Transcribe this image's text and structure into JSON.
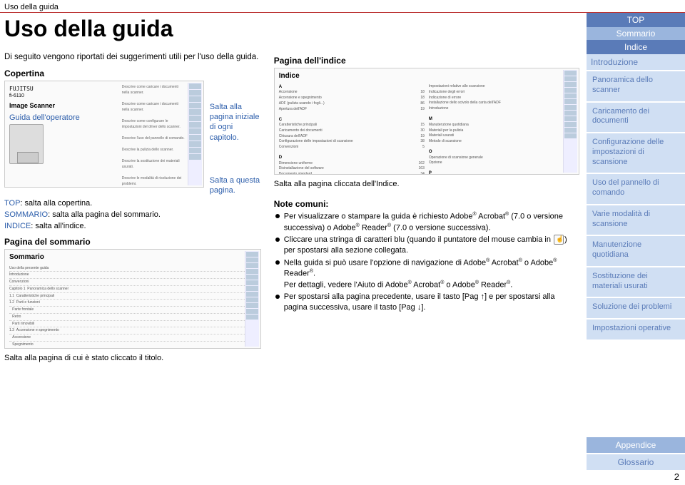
{
  "header": {
    "breadcrumb": "Uso della guida"
  },
  "title": "Uso della guida",
  "intro": "Di seguito vengono riportati dei suggerimenti utili per l'uso della guida.",
  "cover": {
    "heading": "Copertina",
    "brand": "FUJITSU",
    "model": "fi-6110",
    "big": "Image Scanner",
    "guida": "Guida dell'operatore",
    "top": "TOP: salta alla copertina.",
    "summ": "SOMMARIO: salta alla pagina del sommario.",
    "idx": "INDICE: salta all'indice."
  },
  "sommario": {
    "heading": "Pagina del sommario",
    "thumbTitle": "Sommario",
    "caption": "Salta alla pagina di cui è stato cliccato il titolo."
  },
  "callout1": "Salta alla pagina iniziale di ogni capitolo.",
  "callout2": "Salta a questa pagina.",
  "indexPage": {
    "heading": "Pagina dell'indice",
    "thumbTitle": "Indice",
    "caption": "Salta alla pagina cliccata dell'Indice."
  },
  "notes": {
    "heading": "Note comuni:",
    "n1a": "Per visualizzare o stampare la guida è richiesto Adobe",
    "n1b": " Acrobat",
    "n1c": " (7.0 o versione successiva) o Adobe",
    "n1d": " Reader",
    "n1e": " (7.0 o versione successiva).",
    "n2a": "Cliccare una stringa di caratteri blu (quando il puntatore del mouse cambia in ",
    "n2b": ") per spostarsi alla sezione collegata.",
    "n3a": "Nella guida si può usare l'opzione di navigazione di Adobe",
    "n3b": " Acrobat",
    "n3c": " o Adobe",
    "n3d": " Reader",
    "n3e": ".",
    "n3f": "Per dettagli, vedere l'Aiuto di Adobe",
    "n3g": " Acrobat",
    "n3h": " o Adobe",
    "n3i": " Reader",
    "n3j": ".",
    "n4": "Per spostarsi alla pagina precedente, usare il tasto [Pag ↑] e per spostarsi alla pagina successiva, usare il tasto [Pag ↓]."
  },
  "sidebar": {
    "top": "TOP",
    "somm": "Sommario",
    "idx": "Indice",
    "intro": "Introduzione",
    "g1": "Panoramica dello scanner",
    "g2": "Caricamento dei documenti",
    "g3": "Configurazione delle impostazioni di scansione",
    "g4": "Uso del pannello di comando",
    "g5": "Varie modalità di scansione",
    "g6": "Manutenzione quotidiana",
    "g7": "Sostituzione dei materiali usurati",
    "g8": "Soluzione dei problemi",
    "g9": "Impostazioni operative",
    "app": "Appendice",
    "glo": "Glossario"
  },
  "pagenum": "2"
}
